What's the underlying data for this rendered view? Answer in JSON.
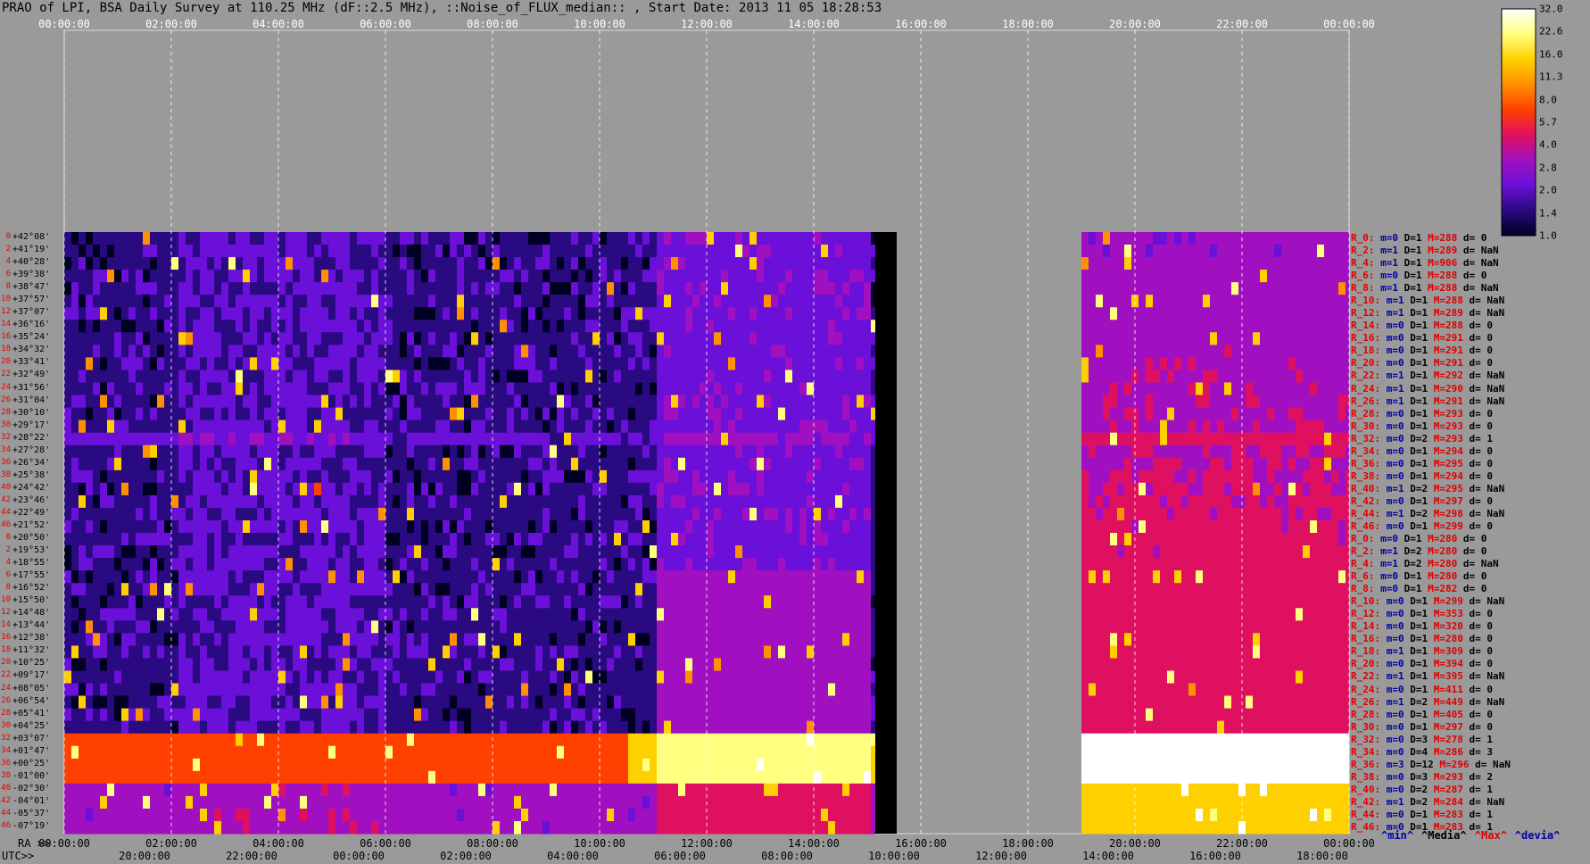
{
  "title": "PRAO of LPI, BSA Daily Survey at 110.25 MHz (dF::2.5 MHz), ::Noise_of_FLUX_median:: , Start Date: 2013 11 05 18:28:53",
  "axes": {
    "top_ticks": [
      "00:00:00",
      "02:00:00",
      "04:00:00",
      "06:00:00",
      "08:00:00",
      "10:00:00",
      "12:00:00",
      "14:00:00",
      "16:00:00",
      "18:00:00",
      "20:00:00",
      "22:00:00",
      "00:00:00"
    ],
    "ra_label": "RA >>",
    "ra_ticks": [
      "00:00:00",
      "02:00:00",
      "04:00:00",
      "06:00:00",
      "08:00:00",
      "10:00:00",
      "12:00:00",
      "14:00:00",
      "16:00:00",
      "18:00:00",
      "20:00:00",
      "22:00:00",
      "00:00:00"
    ],
    "utc_label": "UTC>>",
    "utc_ticks": [
      "20:00:00",
      "22:00:00",
      "00:00:00",
      "02:00:00",
      "04:00:00",
      "06:00:00",
      "08:00:00",
      "10:00:00",
      "12:00:00",
      "14:00:00",
      "16:00:00",
      "18:00:00"
    ]
  },
  "chart_data": {
    "type": "heatmap",
    "title": "PRAO of LPI, BSA Daily Survey at 110.25 MHz (dF::2.5 MHz), ::Noise_of_FLUX_median:: , Start Date: 2013 11 05 18:28:53",
    "x_axis_hours": [
      0,
      24
    ],
    "data_coverage_hours": [
      [
        0,
        15.15
      ],
      [
        19.0,
        24.0
      ]
    ],
    "declinations": [
      "+42°08'",
      "+41°19'",
      "+40°28'",
      "+39°38'",
      "+38°47'",
      "+37°57'",
      "+37°07'",
      "+36°16'",
      "+35°24'",
      "+34°32'",
      "+33°41'",
      "+32°49'",
      "+31°56'",
      "+31°04'",
      "+30°10'",
      "+29°17'",
      "+28°22'",
      "+27°28'",
      "+26°34'",
      "+25°38'",
      "+24°42'",
      "+23°46'",
      "+22°49'",
      "+21°52'",
      "+20°50'",
      "+19°53'",
      "+18°55'",
      "+17°55'",
      "+16°52'",
      "+15°50'",
      "+14°48'",
      "+13°44'",
      "+12°38'",
      "+11°32'",
      "+10°25'",
      "+09°17'",
      "+08°05'",
      "+06°54'",
      "+05°41'",
      "+04°25'",
      "+03°07'",
      "+01°47'",
      "+00°25'",
      "-01°00'",
      "-02°30'",
      "-04°01'",
      "-05°37'",
      "-07°19'"
    ],
    "row_indices": [
      "0",
      "2",
      "4",
      "6",
      "8",
      "10",
      "12",
      "14",
      "16",
      "18",
      "20",
      "22",
      "24",
      "26",
      "28",
      "30",
      "32",
      "34",
      "36",
      "38",
      "40",
      "42",
      "44",
      "46",
      "0",
      "2",
      "4",
      "6",
      "8",
      "10",
      "12",
      "14",
      "16",
      "18",
      "20",
      "22",
      "24",
      "26",
      "28",
      "30",
      "32",
      "34",
      "36",
      "38",
      "40",
      "42",
      "44",
      "46"
    ],
    "colorbar": {
      "ticks": [
        "32.0",
        "22.6",
        "16.0",
        "11.3",
        "8.0",
        "5.7",
        "4.0",
        "2.8",
        "2.0",
        "1.4",
        "1.0"
      ],
      "scale": "log",
      "range": [
        1.0,
        32.0
      ],
      "colors": [
        "#000022",
        "#2a0a80",
        "#6a10d8",
        "#a010c0",
        "#e01060",
        "#ff4000",
        "#ff9000",
        "#ffd000",
        "#ffff80",
        "#ffffff"
      ]
    },
    "row_stats": [
      {
        "r": "R_0:",
        "m": "m=0",
        "d": "D=1",
        "mx": "M=288",
        "dv": "d= 0"
      },
      {
        "r": "R_2:",
        "m": "m=1",
        "d": "D=1",
        "mx": "M=289",
        "dv": "d= NaN"
      },
      {
        "r": "R_4:",
        "m": "m=1",
        "d": "D=1",
        "mx": "M=906",
        "dv": "d= NaN"
      },
      {
        "r": "R_6:",
        "m": "m=0",
        "d": "D=1",
        "mx": "M=288",
        "dv": "d= 0"
      },
      {
        "r": "R_8:",
        "m": "m=1",
        "d": "D=1",
        "mx": "M=288",
        "dv": "d= NaN"
      },
      {
        "r": "R_10:",
        "m": "m=1",
        "d": "D=1",
        "mx": "M=288",
        "dv": "d= NaN"
      },
      {
        "r": "R_12:",
        "m": "m=1",
        "d": "D=1",
        "mx": "M=289",
        "dv": "d= NaN"
      },
      {
        "r": "R_14:",
        "m": "m=0",
        "d": "D=1",
        "mx": "M=288",
        "dv": "d= 0"
      },
      {
        "r": "R_16:",
        "m": "m=0",
        "d": "D=1",
        "mx": "M=291",
        "dv": "d= 0"
      },
      {
        "r": "R_18:",
        "m": "m=0",
        "d": "D=1",
        "mx": "M=291",
        "dv": "d= 0"
      },
      {
        "r": "R_20:",
        "m": "m=0",
        "d": "D=1",
        "mx": "M=291",
        "dv": "d= 0"
      },
      {
        "r": "R_22:",
        "m": "m=1",
        "d": "D=1",
        "mx": "M=292",
        "dv": "d= NaN"
      },
      {
        "r": "R_24:",
        "m": "m=1",
        "d": "D=1",
        "mx": "M=290",
        "dv": "d= NaN"
      },
      {
        "r": "R_26:",
        "m": "m=1",
        "d": "D=1",
        "mx": "M=291",
        "dv": "d= NaN"
      },
      {
        "r": "R_28:",
        "m": "m=0",
        "d": "D=1",
        "mx": "M=293",
        "dv": "d= 0"
      },
      {
        "r": "R_30:",
        "m": "m=0",
        "d": "D=1",
        "mx": "M=293",
        "dv": "d= 0"
      },
      {
        "r": "R_32:",
        "m": "m=0",
        "d": "D=2",
        "mx": "M=293",
        "dv": "d= 1"
      },
      {
        "r": "R_34:",
        "m": "m=0",
        "d": "D=1",
        "mx": "M=294",
        "dv": "d= 0"
      },
      {
        "r": "R_36:",
        "m": "m=0",
        "d": "D=1",
        "mx": "M=295",
        "dv": "d= 0"
      },
      {
        "r": "R_38:",
        "m": "m=0",
        "d": "D=1",
        "mx": "M=294",
        "dv": "d= 0"
      },
      {
        "r": "R_40:",
        "m": "m=1",
        "d": "D=2",
        "mx": "M=295",
        "dv": "d= NaN"
      },
      {
        "r": "R_42:",
        "m": "m=0",
        "d": "D=1",
        "mx": "M=297",
        "dv": "d= 0"
      },
      {
        "r": "R_44:",
        "m": "m=1",
        "d": "D=2",
        "mx": "M=298",
        "dv": "d= NaN"
      },
      {
        "r": "R_46:",
        "m": "m=0",
        "d": "D=1",
        "mx": "M=299",
        "dv": "d= 0"
      },
      {
        "r": "R_0:",
        "m": "m=0",
        "d": "D=1",
        "mx": "M=280",
        "dv": "d= 0"
      },
      {
        "r": "R_2:",
        "m": "m=1",
        "d": "D=2",
        "mx": "M=280",
        "dv": "d= 0"
      },
      {
        "r": "R_4:",
        "m": "m=1",
        "d": "D=2",
        "mx": "M=280",
        "dv": "d= NaN"
      },
      {
        "r": "R_6:",
        "m": "m=0",
        "d": "D=1",
        "mx": "M=280",
        "dv": "d= 0"
      },
      {
        "r": "R_8:",
        "m": "m=0",
        "d": "D=1",
        "mx": "M=282",
        "dv": "d= 0"
      },
      {
        "r": "R_10:",
        "m": "m=0",
        "d": "D=1",
        "mx": "M=299",
        "dv": "d= NaN"
      },
      {
        "r": "R_12:",
        "m": "m=0",
        "d": "D=1",
        "mx": "M=353",
        "dv": "d= 0"
      },
      {
        "r": "R_14:",
        "m": "m=0",
        "d": "D=1",
        "mx": "M=320",
        "dv": "d= 0"
      },
      {
        "r": "R_16:",
        "m": "m=0",
        "d": "D=1",
        "mx": "M=280",
        "dv": "d= 0"
      },
      {
        "r": "R_18:",
        "m": "m=1",
        "d": "D=1",
        "mx": "M=309",
        "dv": "d= 0"
      },
      {
        "r": "R_20:",
        "m": "m=0",
        "d": "D=1",
        "mx": "M=394",
        "dv": "d= 0"
      },
      {
        "r": "R_22:",
        "m": "m=1",
        "d": "D=1",
        "mx": "M=395",
        "dv": "d= NaN"
      },
      {
        "r": "R_24:",
        "m": "m=0",
        "d": "D=1",
        "mx": "M=411",
        "dv": "d= 0"
      },
      {
        "r": "R_26:",
        "m": "m=1",
        "d": "D=2",
        "mx": "M=449",
        "dv": "d= NaN"
      },
      {
        "r": "R_28:",
        "m": "m=0",
        "d": "D=1",
        "mx": "M=405",
        "dv": "d= 0"
      },
      {
        "r": "R_30:",
        "m": "m=0",
        "d": "D=1",
        "mx": "M=297",
        "dv": "d= 0"
      },
      {
        "r": "R_32:",
        "m": "m=0",
        "d": "D=3",
        "mx": "M=278",
        "dv": "d= 1"
      },
      {
        "r": "R_34:",
        "m": "m=0",
        "d": "D=4",
        "mx": "M=286",
        "dv": "d= 3"
      },
      {
        "r": "R_36:",
        "m": "m=3",
        "d": "D=12",
        "mx": "M=296",
        "dv": "d= NaN"
      },
      {
        "r": "R_38:",
        "m": "m=0",
        "d": "D=3",
        "mx": "M=293",
        "dv": "d= 2"
      },
      {
        "r": "R_40:",
        "m": "m=0",
        "d": "D=2",
        "mx": "M=287",
        "dv": "d= 1"
      },
      {
        "r": "R_42:",
        "m": "m=1",
        "d": "D=2",
        "mx": "M=284",
        "dv": "d= NaN"
      },
      {
        "r": "R_44:",
        "m": "m=0",
        "d": "D=1",
        "mx": "M=283",
        "dv": "d= 1"
      },
      {
        "r": "R_46:",
        "m": "m=0",
        "d": "D=1",
        "mx": "M=283",
        "dv": "d= 1"
      }
    ],
    "legend": [
      {
        "label": "^min^",
        "color": "#0000aa"
      },
      {
        "label": "^Media^",
        "color": "#000000"
      },
      {
        "label": "^Max^",
        "color": "#e00000"
      },
      {
        "label": "^devia^",
        "color": "#0000aa"
      }
    ]
  }
}
